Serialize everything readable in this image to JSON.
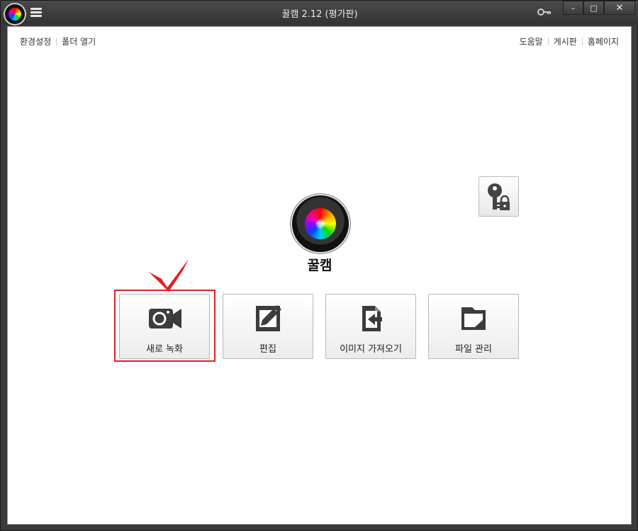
{
  "window": {
    "title": "꿀캠 2.12 (평가판)"
  },
  "title_buttons": {
    "minimize": "–",
    "maximize": "□",
    "close": "✕"
  },
  "menu": {
    "left_links": [
      "환경설정",
      "폴더 열기"
    ],
    "right_links": [
      "도움말",
      "게시판",
      "홈페이지"
    ]
  },
  "main": {
    "app_name": "꿀캠",
    "actions": [
      {
        "label": "새로 녹화",
        "icon": "video-camera-icon"
      },
      {
        "label": "편집",
        "icon": "edit-icon"
      },
      {
        "label": "이미지 가져오기",
        "icon": "import-image-icon"
      },
      {
        "label": "파일 관리",
        "icon": "folder-icon"
      }
    ]
  },
  "colors": {
    "highlight": "#e02020",
    "titlebar": "#3a3a3a",
    "content_bg": "#ffffff"
  }
}
